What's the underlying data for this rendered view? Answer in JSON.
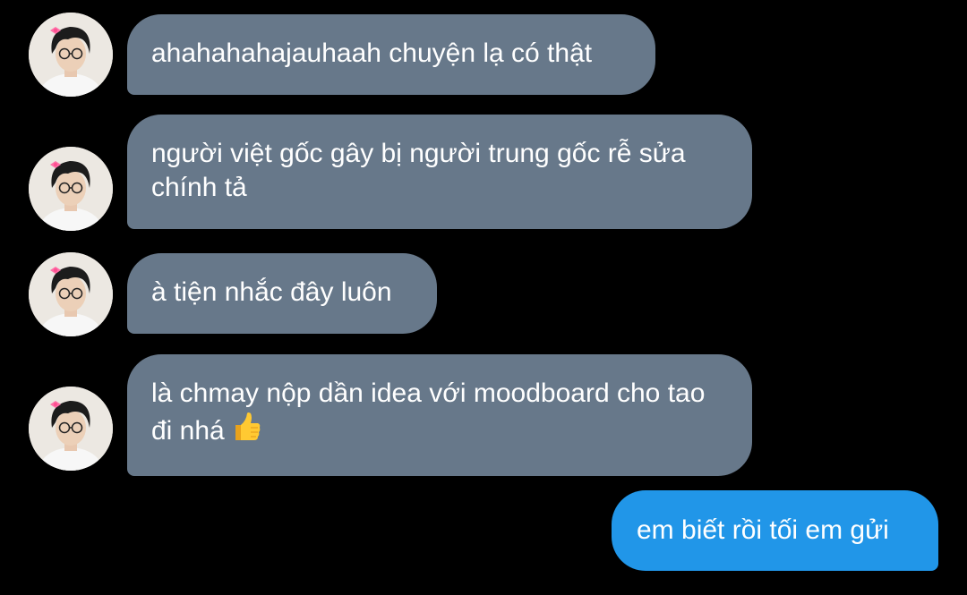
{
  "colors": {
    "background": "#000000",
    "incoming_bubble": "#67788a",
    "outgoing_bubble": "#2196e8",
    "text": "#ffffff"
  },
  "messages": [
    {
      "direction": "incoming",
      "avatar": "contact-avatar",
      "text": "ahahahahajauhaah chuyện lạ có thật"
    },
    {
      "direction": "incoming",
      "avatar": "contact-avatar",
      "text": "người việt gốc gây bị người trung gốc rễ sửa chính tả"
    },
    {
      "direction": "incoming",
      "avatar": "contact-avatar",
      "text": "à tiện nhắc đây luôn"
    },
    {
      "direction": "incoming",
      "avatar": "contact-avatar",
      "text": "là chmay nộp dần idea với moodboard cho tao đi nhá",
      "emoji": "thumbs-up-icon"
    },
    {
      "direction": "outgoing",
      "text": "em biết rồi tối em gửi"
    }
  ]
}
